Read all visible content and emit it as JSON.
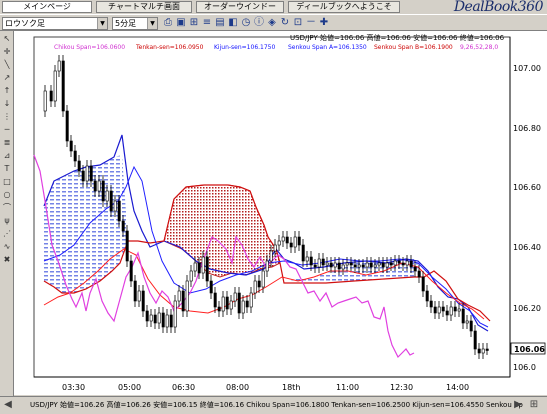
{
  "tabs": [
    {
      "label": "メインページ",
      "active": true
    },
    {
      "label": "チャートマルチ画面",
      "active": false
    },
    {
      "label": "オーダーウインドー",
      "active": false
    },
    {
      "label": "ディールブックへようこそ",
      "active": false
    }
  ],
  "brand": "DealBook360",
  "toolbar": {
    "fix_select": "ロウソク足",
    "timeframe_select": "5分足"
  },
  "chart": {
    "header_line": "USD/JPY 始値=106.06 高値=106.06 安値=106.06 終値=106.06",
    "indicator_label": {
      "chikou": "Chikou Span=106.0600",
      "tenkan": "Tenkan-sen=106.0950",
      "kijun": "Kijun-sen=106.1750",
      "senkou_a": "Senkou Span A=106.1350",
      "senkou_b": "Senkou Span B=106.1900",
      "params": "9,26,52,28,0"
    },
    "colors": {
      "chikou": "#e040e0",
      "tenkan": "#ff0000",
      "kijun": "#1010ff",
      "cloud_blue": "#6d7ee8",
      "cloud_red": "#c02020",
      "candle": "#000000"
    },
    "current_price": "106.06",
    "price_labels": [
      "107.00",
      "106.80",
      "106.60",
      "106.40",
      "106.20",
      "106.0"
    ],
    "time_labels": [
      "03:30",
      "05:00",
      "06:30",
      "08:00",
      "18th",
      "11:00",
      "12:30",
      "14:00"
    ]
  },
  "status": "USD/JPY 始値=106.26 高値=106.26 安値=106.15 終値=106.16   Chikou Span=106.1800 Tenkan-sen=106.2500 Kijun-sen=106.4550 Senkou Sp"
}
